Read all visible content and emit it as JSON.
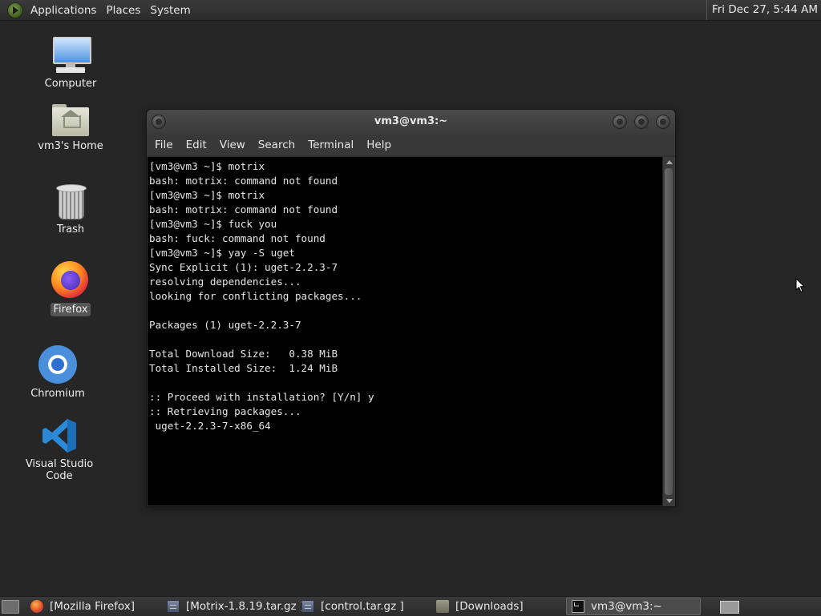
{
  "top_panel": {
    "menus": [
      "Applications",
      "Places",
      "System"
    ],
    "clock": "Fri Dec 27,  5:44 AM",
    "apps_icon": "gnome-foot-icon"
  },
  "desktop_icons": [
    {
      "label": "Computer",
      "icon": "computer-icon"
    },
    {
      "label": "vm3's Home",
      "icon": "home-folder-icon"
    },
    {
      "label": "Trash",
      "icon": "trash-icon"
    },
    {
      "label": "Firefox",
      "icon": "firefox-icon",
      "selected": true
    },
    {
      "label": "Chromium",
      "icon": "chromium-icon"
    },
    {
      "label": "Visual Studio Code",
      "icon": "vscode-icon"
    }
  ],
  "terminal": {
    "title": "vm3@vm3:~",
    "menu": [
      "File",
      "Edit",
      "View",
      "Search",
      "Terminal",
      "Help"
    ],
    "output": "[vm3@vm3 ~]$ motrix\nbash: motrix: command not found\n[vm3@vm3 ~]$ motrix\nbash: motrix: command not found\n[vm3@vm3 ~]$ fuck you\nbash: fuck: command not found\n[vm3@vm3 ~]$ yay -S uget\nSync Explicit (1): uget-2.2.3-7\nresolving dependencies...\nlooking for conflicting packages...\n\nPackages (1) uget-2.2.3-7\n\nTotal Download Size:   0.38 MiB\nTotal Installed Size:  1.24 MiB\n\n:: Proceed with installation? [Y/n] y\n:: Retrieving packages...\n uget-2.2.3-7-x86_64"
  },
  "taskbar": {
    "items": [
      {
        "label": "[Mozilla Firefox]",
        "icon": "firefox-icon"
      },
      {
        "label": "[Motrix-1.8.19.tar.gz ]",
        "icon": "archive-icon"
      },
      {
        "label": "[control.tar.gz ]",
        "icon": "archive-icon"
      },
      {
        "label": "[Downloads]",
        "icon": "folder-icon"
      },
      {
        "label": "vm3@vm3:~",
        "icon": "terminal-icon",
        "active": true
      }
    ]
  },
  "colors": {
    "desktop_bg": "#262626",
    "panel_bg": "#333333",
    "terminal_bg": "#000000",
    "terminal_fg": "#e6e6e6"
  }
}
